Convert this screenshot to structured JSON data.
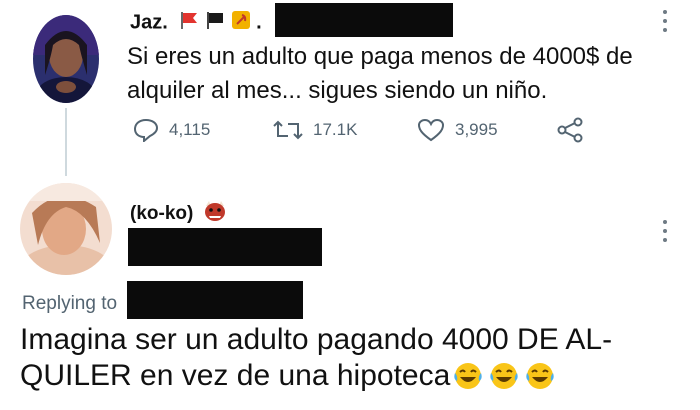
{
  "tweet": {
    "author_name": "Jaz.",
    "text": "Si eres un adulto que paga menos de 4000$ de alquiler al mes... sigues siendo un niño.",
    "actions": {
      "replies": "4,115",
      "retweets": "17.1K",
      "likes": "3,995"
    }
  },
  "reply": {
    "author_name": "(ko-ko)",
    "replying_to_label": "Replying to",
    "text": "Imagina ser un adulto pagando 4000 DE AL-QUILER en vez de una hipoteca",
    "emoji_icons": [
      "joy-emoji-icon",
      "joy-emoji-icon",
      "joy-emoji-icon"
    ]
  },
  "colors": {
    "text": "#111111",
    "muted": "#536471",
    "redaction": "#0b0b0b",
    "thread_line": "#cfd9de"
  }
}
